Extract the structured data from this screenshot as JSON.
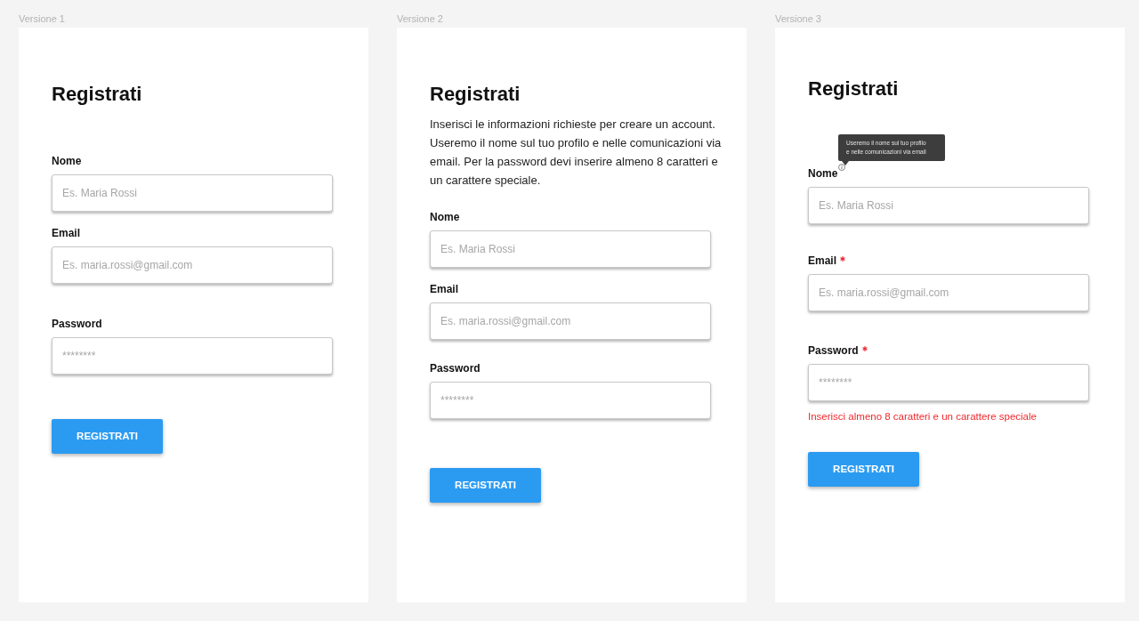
{
  "artboards": [
    {
      "label": "Versione 1",
      "form": {
        "title": "Registrati",
        "fields": [
          {
            "label": "Nome",
            "placeholder": "Es. Maria Rossi"
          },
          {
            "label": "Email",
            "placeholder": "Es. maria.rossi@gmail.com"
          },
          {
            "label": "Password",
            "placeholder": "********"
          }
        ],
        "submit": "REGISTRATI"
      }
    },
    {
      "label": "Versione 2",
      "form": {
        "title": "Registrati",
        "description": "Inserisci le informazioni richieste per creare un account. Useremo il nome sul tuo profilo e nelle comunicazioni via email. Per la password devi inserire almeno 8 caratteri e un carattere speciale.",
        "fields": [
          {
            "label": "Nome",
            "placeholder": "Es. Maria Rossi"
          },
          {
            "label": "Email",
            "placeholder": "Es. maria.rossi@gmail.com"
          },
          {
            "label": "Password",
            "placeholder": "********"
          }
        ],
        "submit": "REGISTRATI"
      }
    },
    {
      "label": "Versione 3",
      "form": {
        "title": "Registrati",
        "fields": [
          {
            "label": "Nome",
            "required": false,
            "placeholder": "Es. Maria Rossi",
            "tooltip": {
              "lines": [
                "Useremo il nome sul tuo profilo",
                "e nelle comunicazioni via email"
              ]
            }
          },
          {
            "label": "Email",
            "required": true,
            "placeholder": "Es. maria.rossi@gmail.com"
          },
          {
            "label": "Password",
            "required": true,
            "placeholder": "********",
            "error": "Inserisci almeno 8 caratteri e un carattere speciale"
          }
        ],
        "submit": "REGISTRATI"
      }
    }
  ]
}
